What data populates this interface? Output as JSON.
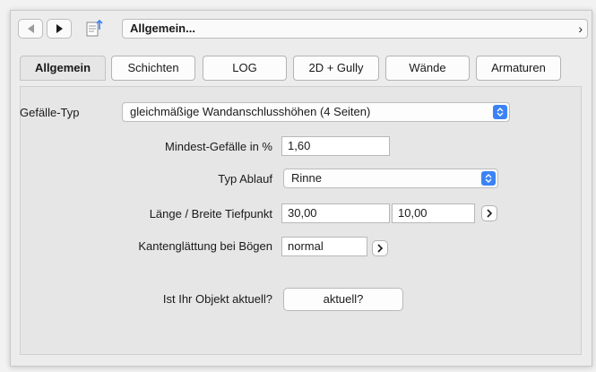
{
  "navbar": {
    "back_icon": "triangle-left-icon",
    "forward_icon": "triangle-right-icon",
    "document_icon": "document-up-icon",
    "path": "Allgemein...",
    "chevron": "›"
  },
  "tabs": [
    {
      "label": "Allgemein",
      "active": true
    },
    {
      "label": "Schichten",
      "active": false
    },
    {
      "label": "LOG",
      "active": false
    },
    {
      "label": "2D + Gully",
      "active": false
    },
    {
      "label": "Wände",
      "active": false
    },
    {
      "label": "Armaturen",
      "active": false
    }
  ],
  "form": {
    "gefaelle_typ": {
      "label": "Gefälle-Typ",
      "value": "gleichmäßige Wandanschlusshöhen (4 Seiten)"
    },
    "mindest_gefaelle": {
      "label": "Mindest-Gefälle in %",
      "value": "1,60"
    },
    "typ_ablauf": {
      "label": "Typ Ablauf",
      "value": "Rinne"
    },
    "laenge_breite": {
      "label": "Länge / Breite Tiefpunkt",
      "value1": "30,00",
      "value2": "10,00"
    },
    "kantenglaettung": {
      "label": "Kantenglättung bei Bögen",
      "value": "normal"
    },
    "aktuell": {
      "label": "Ist Ihr Objekt aktuell?",
      "button": "aktuell?"
    }
  },
  "colors": {
    "accent": "#3b82f6"
  }
}
